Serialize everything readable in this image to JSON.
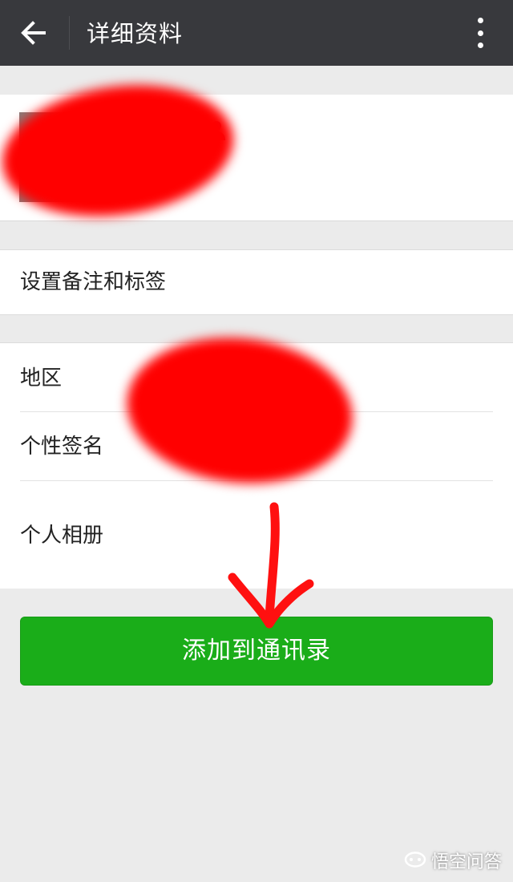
{
  "header": {
    "title": "详细资料",
    "back_icon": "arrow-left-icon",
    "more_icon": "more-vertical-icon"
  },
  "profile": {
    "gender_icon": "person-icon"
  },
  "remark": {
    "label": "设置备注和标签"
  },
  "info": {
    "region_label": "地区",
    "signature_label": "个性签名",
    "album_label": "个人相册"
  },
  "actions": {
    "add_contact_label": "添加到通讯录"
  },
  "colors": {
    "topbar": "#38393d",
    "primary_green": "#1aad19",
    "annotation_red": "#ff0000"
  },
  "watermark": {
    "text": "悟空问答"
  }
}
